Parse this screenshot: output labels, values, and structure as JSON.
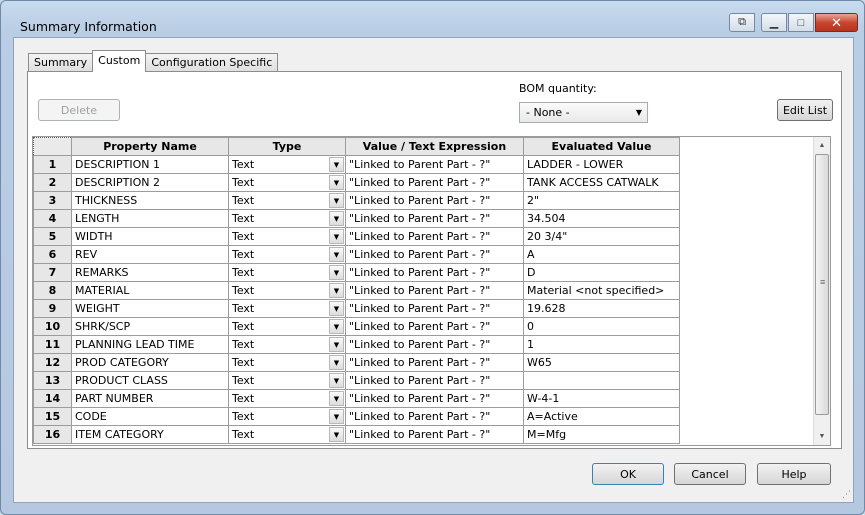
{
  "window": {
    "title": "Summary Information"
  },
  "tabs": [
    {
      "label": "Summary"
    },
    {
      "label": "Custom"
    },
    {
      "label": "Configuration Specific"
    }
  ],
  "toolbar": {
    "delete_label": "Delete",
    "bom_label": "BOM quantity:",
    "bom_value": "- None -",
    "edit_list_label": "Edit List"
  },
  "grid": {
    "columns": [
      "Property Name",
      "Type",
      "Value / Text Expression",
      "Evaluated Value"
    ],
    "rows": [
      {
        "num": "1",
        "name": "DESCRIPTION 1",
        "type": "Text",
        "value": "\"Linked to Parent Part - ?\"",
        "evaluated": "LADDER - LOWER"
      },
      {
        "num": "2",
        "name": "DESCRIPTION 2",
        "type": "Text",
        "value": "\"Linked to Parent Part - ?\"",
        "evaluated": "TANK ACCESS CATWALK"
      },
      {
        "num": "3",
        "name": "THICKNESS",
        "type": "Text",
        "value": "\"Linked to Parent Part - ?\"",
        "evaluated": "2\""
      },
      {
        "num": "4",
        "name": "LENGTH",
        "type": "Text",
        "value": "\"Linked to Parent Part - ?\"",
        "evaluated": "34.504"
      },
      {
        "num": "5",
        "name": "WIDTH",
        "type": "Text",
        "value": "\"Linked to Parent Part - ?\"",
        "evaluated": "20 3/4\""
      },
      {
        "num": "6",
        "name": "REV",
        "type": "Text",
        "value": "\"Linked to Parent Part - ?\"",
        "evaluated": "A"
      },
      {
        "num": "7",
        "name": "REMARKS",
        "type": "Text",
        "value": "\"Linked to Parent Part - ?\"",
        "evaluated": "D"
      },
      {
        "num": "8",
        "name": "MATERIAL",
        "type": "Text",
        "value": "\"Linked to Parent Part - ?\"",
        "evaluated": "Material <not specified>"
      },
      {
        "num": "9",
        "name": "WEIGHT",
        "type": "Text",
        "value": "\"Linked to Parent Part - ?\"",
        "evaluated": "19.628"
      },
      {
        "num": "10",
        "name": "SHRK/SCP",
        "type": "Text",
        "value": "\"Linked to Parent Part - ?\"",
        "evaluated": "0"
      },
      {
        "num": "11",
        "name": "PLANNING LEAD TIME",
        "type": "Text",
        "value": "\"Linked to Parent Part - ?\"",
        "evaluated": "1"
      },
      {
        "num": "12",
        "name": "PROD CATEGORY",
        "type": "Text",
        "value": "\"Linked to Parent Part - ?\"",
        "evaluated": "W65"
      },
      {
        "num": "13",
        "name": "PRODUCT CLASS",
        "type": "Text",
        "value": "\"Linked to Parent Part - ?\"",
        "evaluated": ""
      },
      {
        "num": "14",
        "name": "PART NUMBER",
        "type": "Text",
        "value": "\"Linked to Parent Part - ?\"",
        "evaluated": "W-4-1"
      },
      {
        "num": "15",
        "name": "CODE",
        "type": "Text",
        "value": "\"Linked to Parent Part - ?\"",
        "evaluated": "A=Active"
      },
      {
        "num": "16",
        "name": "ITEM CATEGORY",
        "type": "Text",
        "value": "\"Linked to Parent Part - ?\"",
        "evaluated": "M=Mfg"
      }
    ]
  },
  "footer": {
    "ok_label": "OK",
    "cancel_label": "Cancel",
    "help_label": "Help"
  }
}
